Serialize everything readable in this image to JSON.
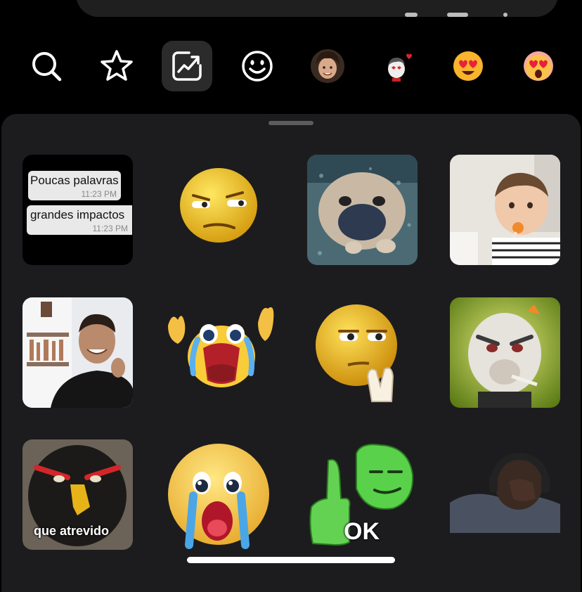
{
  "tabs": [
    {
      "name": "search-tab",
      "icon": "search-icon"
    },
    {
      "name": "favorites-tab",
      "icon": "star-icon"
    },
    {
      "name": "trending-tab",
      "icon": "trending-chart-icon",
      "selected": true
    },
    {
      "name": "emoji-tab",
      "icon": "smiley-icon"
    },
    {
      "name": "avatar-tab",
      "icon": "person-avatar-icon"
    },
    {
      "name": "sticker-pack-tab",
      "icon": "cartoon-sticker-icon"
    },
    {
      "name": "heart-eyes-tab",
      "icon": "heart-eyes-emoji-icon"
    },
    {
      "name": "heart-eyes-alt-tab",
      "icon": "heart-eyes-emoji-icon"
    }
  ],
  "stickers": {
    "chat": {
      "msg1": "Poucas palavras",
      "time1": "11:23 PM",
      "msg2": "grandes impactos",
      "time2": "11:23 PM"
    },
    "que_atrevido": "que atrevido",
    "ok": "OK"
  },
  "colors": {
    "background": "#000000",
    "sheet": "#1c1c1e",
    "selected_tab": "#2b2b2b"
  }
}
